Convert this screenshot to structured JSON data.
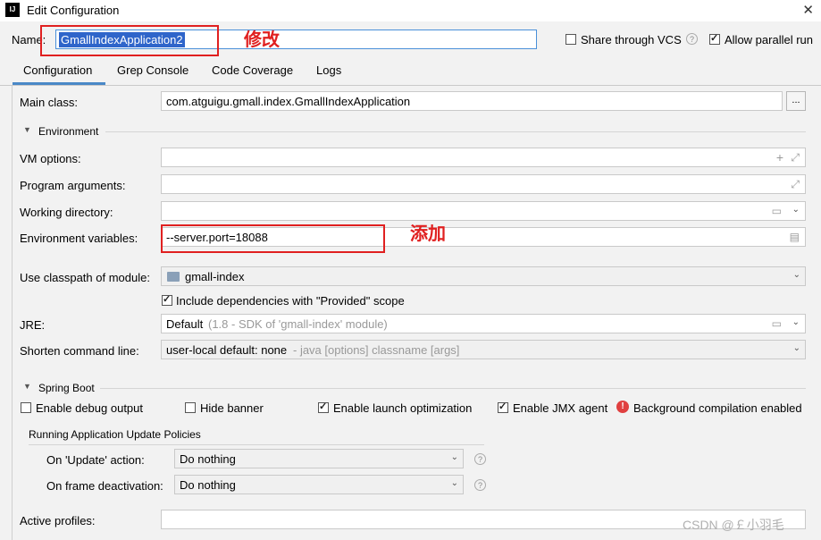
{
  "window": {
    "title": "Edit Configuration",
    "app_icon": "IJ"
  },
  "header": {
    "name_label": "Name:",
    "name_value": "GmallIndexApplication2",
    "share_label": "Share through VCS",
    "share_checked": false,
    "parallel_label": "Allow parallel run",
    "parallel_checked": true
  },
  "tabs": [
    {
      "label": "Configuration",
      "active": true
    },
    {
      "label": "Grep Console",
      "active": false
    },
    {
      "label": "Code Coverage",
      "active": false
    },
    {
      "label": "Logs",
      "active": false
    }
  ],
  "config": {
    "main_class_label": "Main class:",
    "main_class_value": "com.atguigu.gmall.index.GmallIndexApplication",
    "browse_label": "...",
    "environment_header": "Environment",
    "vm_options_label": "VM options:",
    "program_args_label": "Program arguments:",
    "working_dir_label": "Working directory:",
    "env_vars_label": "Environment variables:",
    "env_vars_value": "--server.port=18088",
    "classpath_label": "Use classpath of module:",
    "classpath_value": "gmall-index",
    "include_deps_label": "Include dependencies with \"Provided\" scope",
    "include_deps_checked": true,
    "jre_label": "JRE:",
    "jre_value": "Default",
    "jre_hint": "(1.8 - SDK of 'gmall-index' module)",
    "shorten_label": "Shorten command line:",
    "shorten_value": "user-local default: none",
    "shorten_hint": "- java [options] classname [args]"
  },
  "spring_boot": {
    "header": "Spring Boot",
    "debug_output_label": "Enable debug output",
    "debug_output_checked": false,
    "hide_banner_label": "Hide banner",
    "hide_banner_checked": false,
    "launch_opt_label": "Enable launch optimization",
    "launch_opt_checked": true,
    "jmx_label": "Enable JMX agent",
    "jmx_checked": true,
    "bg_compile_label": "Background compilation enabled",
    "update_policies_header": "Running Application Update Policies",
    "on_update_label": "On 'Update' action:",
    "on_update_value": "Do nothing",
    "on_frame_label": "On frame deactivation:",
    "on_frame_value": "Do nothing",
    "active_profiles_label": "Active profiles:"
  },
  "annotations": {
    "modify": "修改",
    "add": "添加"
  },
  "watermark": "CSDN @￡小羽毛",
  "colors": {
    "accent": "#4a88c7",
    "selection": "#2f65ca",
    "annotation_red": "#e02020"
  }
}
